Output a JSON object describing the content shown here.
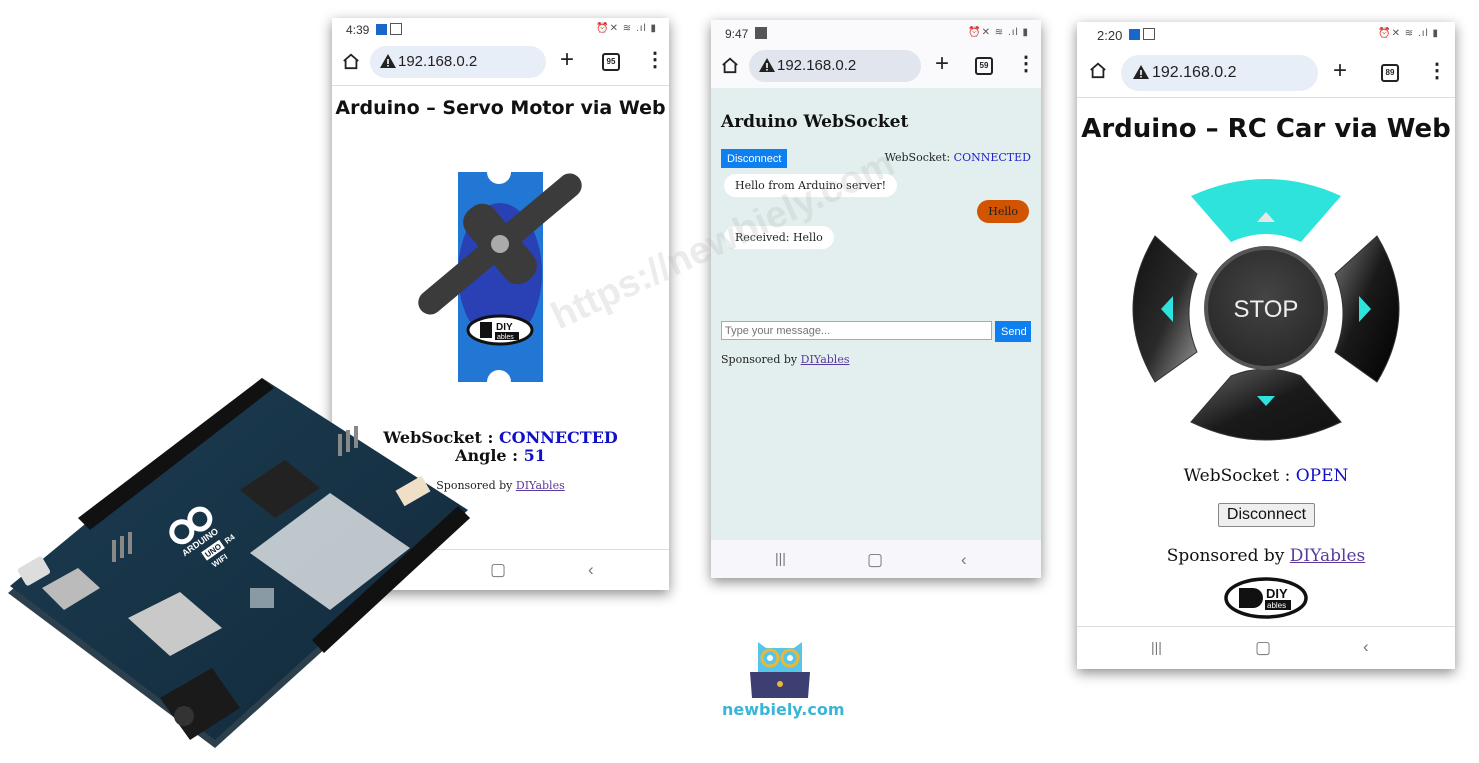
{
  "watermark": "https://newbiely.com",
  "brand": {
    "name": "newbiely.com",
    "accent": "#3bb5d6"
  },
  "board": {
    "brand_text": "ARDUINO",
    "model_line1": "UNO",
    "model_line2": "R4",
    "model_line3": "WIFI"
  },
  "phones": [
    {
      "status_time": "4:39",
      "url": "192.168.0.2",
      "tab_count": "95",
      "page_title": "Arduino – Servo Motor via Web",
      "ws_label": "WebSocket : ",
      "ws_status": "CONNECTED",
      "angle_label": "Angle : ",
      "angle_value": "51",
      "sponsor_prefix": "Sponsored by ",
      "sponsor_link": "DIYables",
      "logo_top": "DIY",
      "logo_bottom": "ables"
    },
    {
      "status_time": "9:47",
      "url": "192.168.0.2",
      "tab_count": "59",
      "page_title": "Arduino WebSocket",
      "disconnect_label": "Disconnect",
      "ws_label": "WebSocket: ",
      "ws_status": "CONNECTED",
      "messages": [
        {
          "side": "left",
          "text": "Hello from Arduino server!"
        },
        {
          "side": "right",
          "text": "Hello"
        },
        {
          "side": "left",
          "text": "Received: Hello"
        }
      ],
      "input_placeholder": "Type your message...",
      "send_label": "Send",
      "sponsor_prefix": "Sponsored by ",
      "sponsor_link": "DIYables",
      "bg_color": "#e2efee",
      "button_color": "#0d7ff0",
      "bubble_color": "#d35400"
    },
    {
      "status_time": "2:20",
      "url": "192.168.0.2",
      "tab_count": "89",
      "page_title": "Arduino – RC Car via Web",
      "stop_label": "STOP",
      "ws_label": "WebSocket : ",
      "ws_status": "OPEN",
      "disconnect_label": "Disconnect",
      "sponsor_prefix": "Sponsored by ",
      "sponsor_link": "DIYables",
      "logo_top": "DIY",
      "logo_bottom": "ables",
      "accent": "#2de3dc"
    }
  ]
}
